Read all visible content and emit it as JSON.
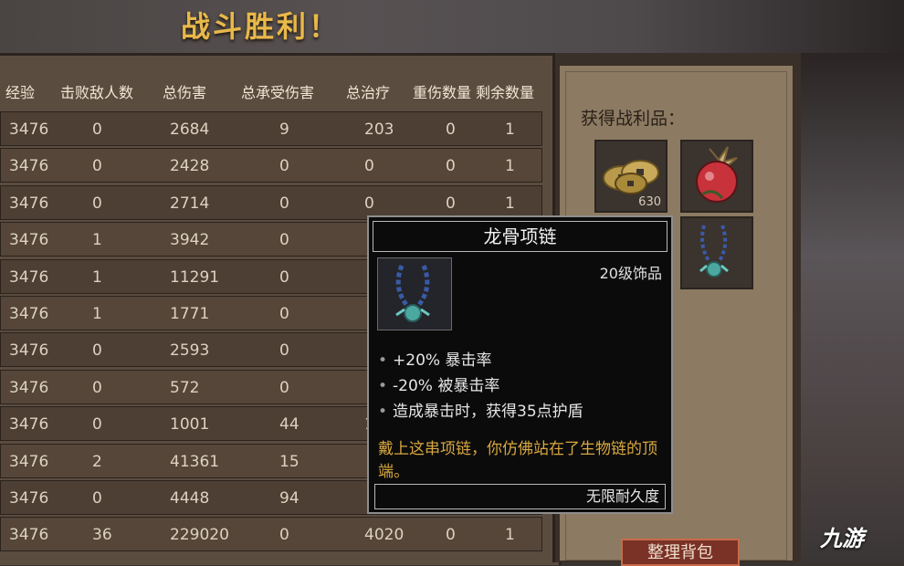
{
  "title": "战斗胜利！",
  "columns": [
    "经验",
    "击败敌人数",
    "总伤害",
    "总承受伤害",
    "总治疗",
    "重伤数量",
    "剩余数量"
  ],
  "rows": [
    [
      "3476",
      "0",
      "2684",
      "9",
      "203",
      "0",
      "1"
    ],
    [
      "3476",
      "0",
      "2428",
      "0",
      "0",
      "0",
      "1"
    ],
    [
      "3476",
      "0",
      "2714",
      "0",
      "0",
      "0",
      "1"
    ],
    [
      "3476",
      "1",
      "3942",
      "0",
      "",
      "",
      ""
    ],
    [
      "3476",
      "1",
      "11291",
      "0",
      "",
      "",
      ""
    ],
    [
      "3476",
      "1",
      "1771",
      "0",
      "",
      "",
      ""
    ],
    [
      "3476",
      "0",
      "2593",
      "0",
      "",
      "",
      ""
    ],
    [
      "3476",
      "0",
      "572",
      "0",
      "",
      "",
      ""
    ],
    [
      "3476",
      "0",
      "1001",
      "44",
      "1",
      "",
      ""
    ],
    [
      "3476",
      "2",
      "41361",
      "15",
      "",
      "",
      ""
    ],
    [
      "3476",
      "0",
      "4448",
      "94",
      "",
      "",
      ""
    ],
    [
      "3476",
      "36",
      "229020",
      "0",
      "4020",
      "0",
      "1"
    ]
  ],
  "loot": {
    "label": "获得战利品：",
    "items": [
      {
        "icon": "coins-icon",
        "count": "630"
      },
      {
        "icon": "red-fruit-icon",
        "count": ""
      },
      {
        "icon": "necklace-icon",
        "count": ""
      }
    ]
  },
  "tooltip": {
    "name": "龙骨项链",
    "level": "20级饰品",
    "stats": [
      "+20% 暴击率",
      "-20% 被暴击率",
      "造成暴击时，获得35点护盾"
    ],
    "lore": "戴上这串项链，你仿佛站在了生物链的顶端。",
    "durability": "无限耐久度",
    "bullet": "•"
  },
  "sort_button": "整理背包",
  "watermark": "九游",
  "colors": {
    "title": "#e8b84a",
    "lore": "#d8a840",
    "button": "#7a3226"
  }
}
